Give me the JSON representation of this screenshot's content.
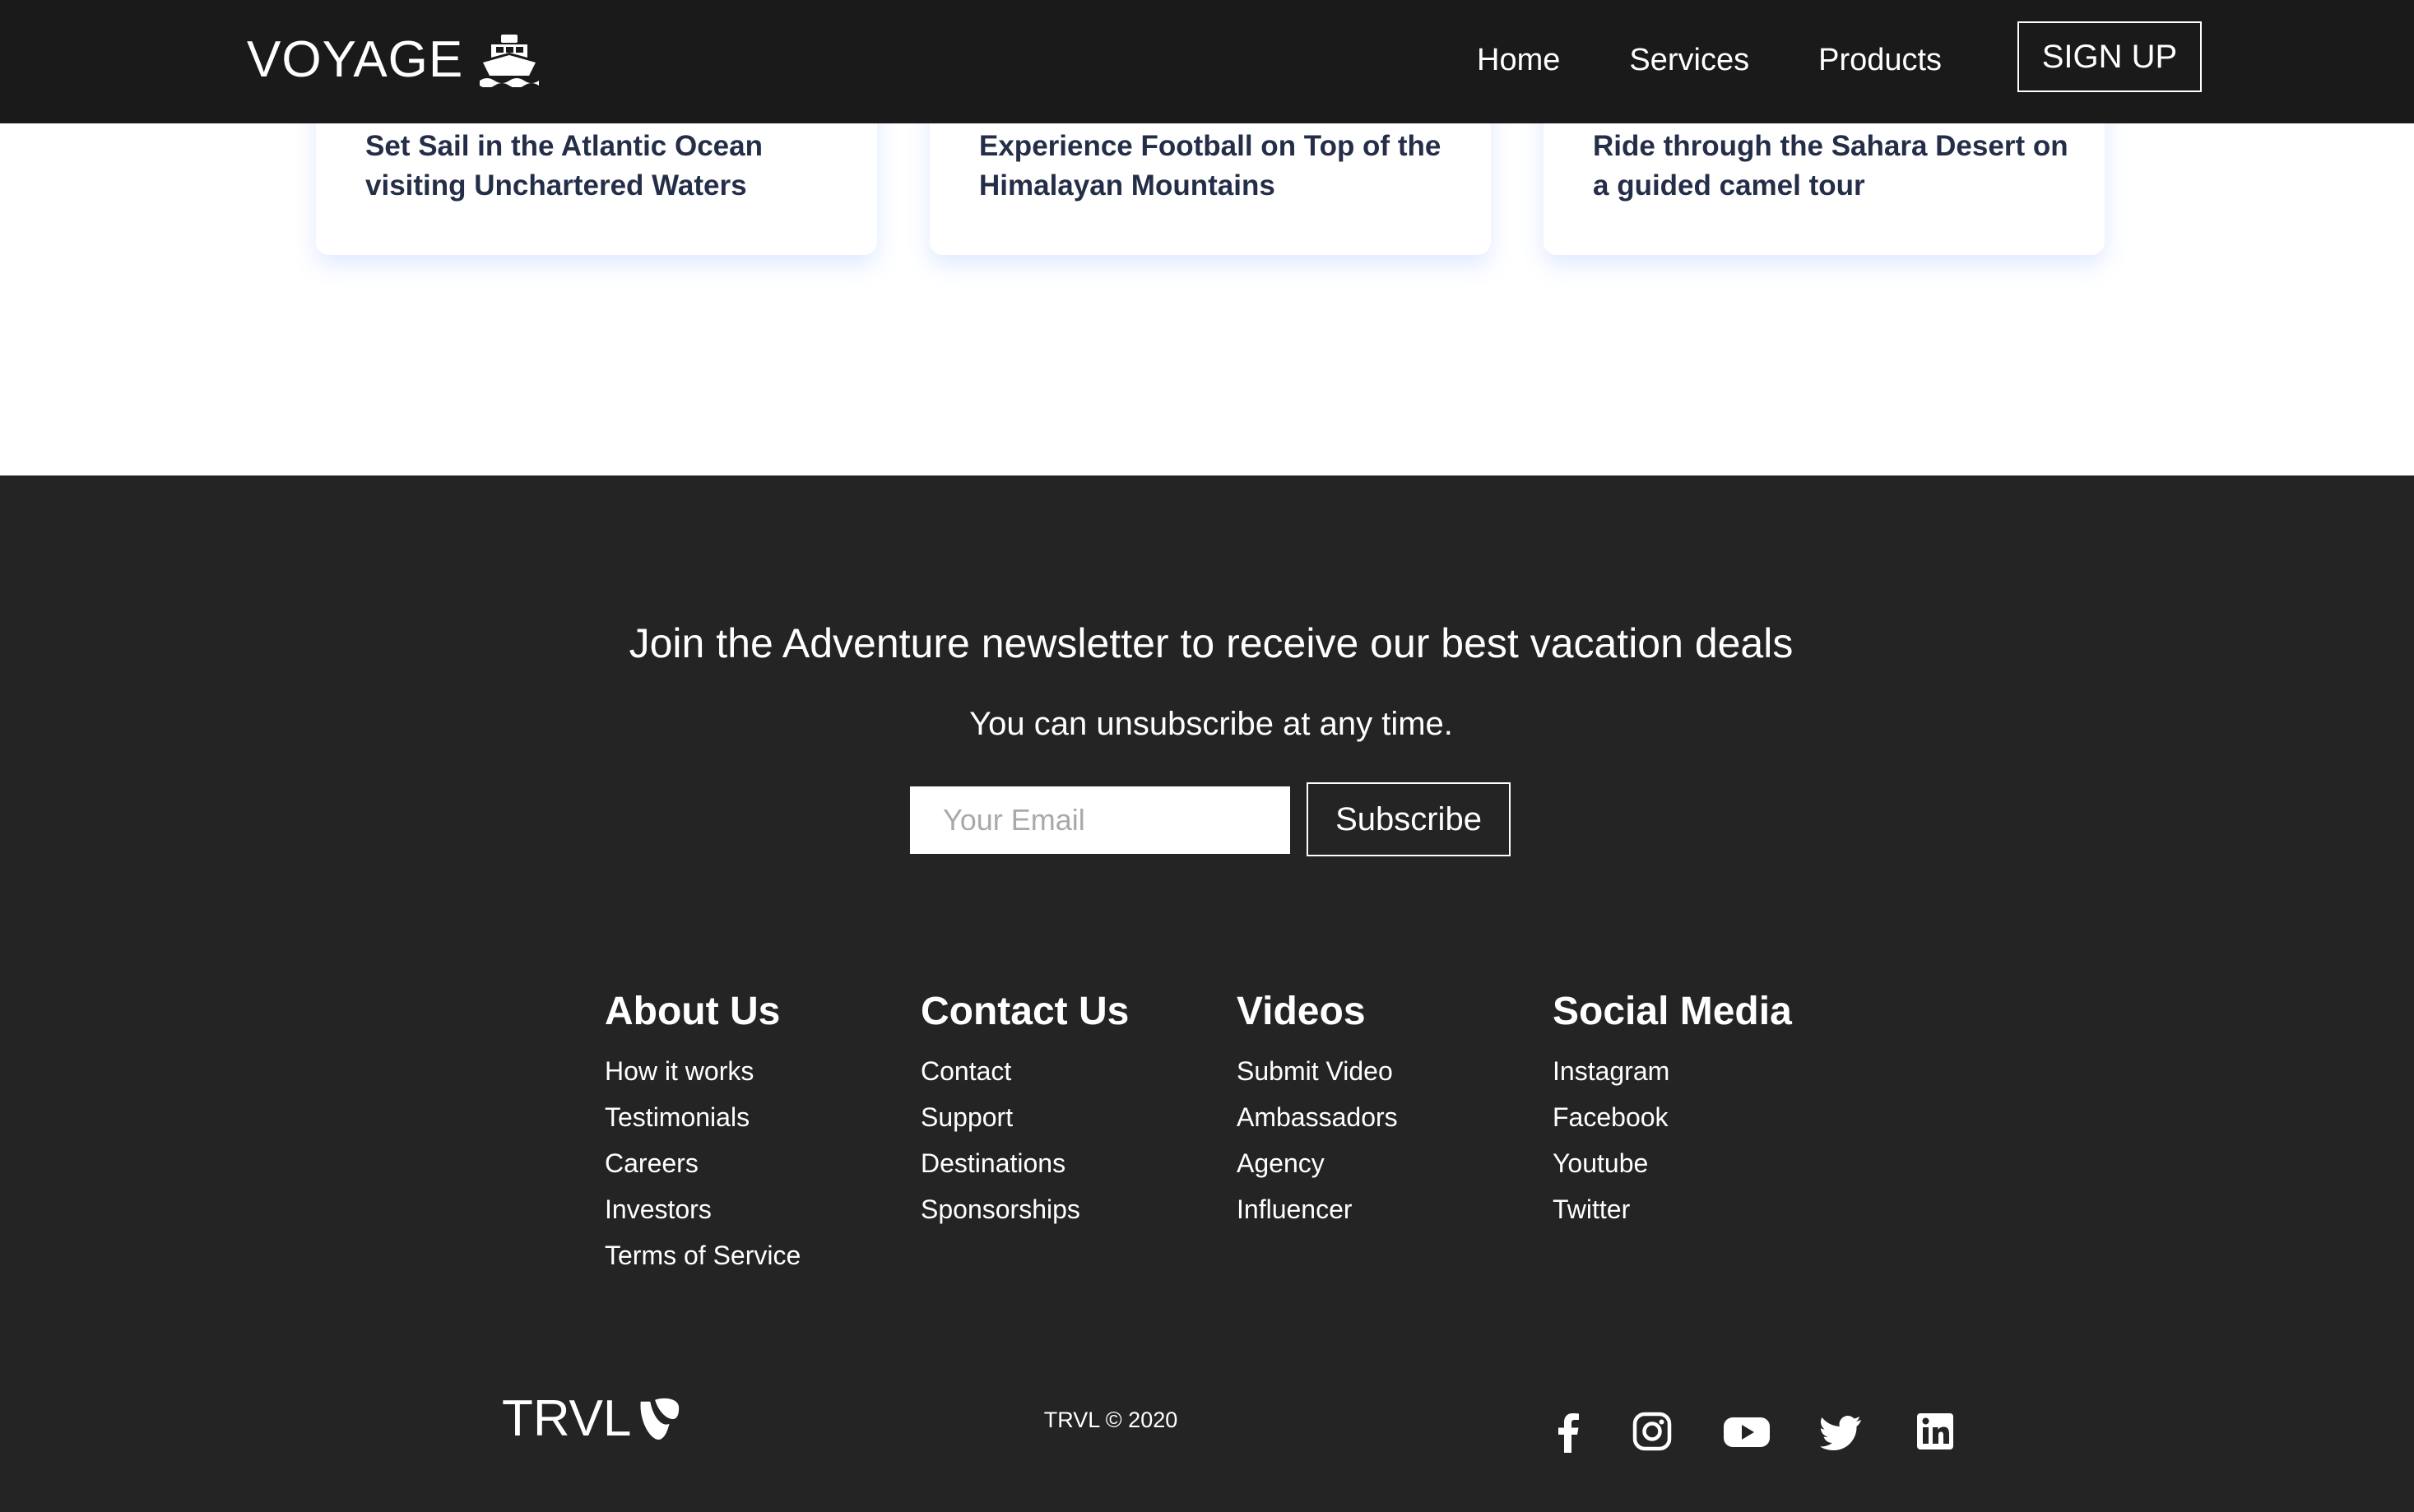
{
  "navbar": {
    "logo_text": "VOYAGE",
    "logo_icon": "ship-icon",
    "links": [
      "Home",
      "Services",
      "Products"
    ],
    "signup_label": "SIGN UP"
  },
  "cards": [
    {
      "title": "Set Sail in the Atlantic Ocean visiting Unchartered Waters"
    },
    {
      "title": "Experience Football on Top of the Himalayan Mountains"
    },
    {
      "title": "Ride through the Sahara Desert on a guided camel tour"
    }
  ],
  "newsletter": {
    "heading": "Join the Adventure newsletter to receive our best vacation deals",
    "subtext": "You can unsubscribe at any time.",
    "email_placeholder": "Your Email",
    "email_value": "",
    "subscribe_label": "Subscribe"
  },
  "footer_columns": [
    {
      "heading": "About Us",
      "links": [
        "How it works",
        "Testimonials",
        "Careers",
        "Investors",
        "Terms of Service"
      ]
    },
    {
      "heading": "Contact Us",
      "links": [
        "Contact",
        "Support",
        "Destinations",
        "Sponsorships"
      ]
    },
    {
      "heading": "Videos",
      "links": [
        "Submit Video",
        "Ambassadors",
        "Agency",
        "Influencer"
      ]
    },
    {
      "heading": "Social Media",
      "links": [
        "Instagram",
        "Facebook",
        "Youtube",
        "Twitter"
      ]
    }
  ],
  "bottom": {
    "logo_text": "TRVL",
    "logo_icon": "typo3-icon",
    "copyright": "TRVL © 2020",
    "social_icons": [
      "facebook-icon",
      "instagram-icon",
      "youtube-icon",
      "twitter-icon",
      "linkedin-icon"
    ]
  },
  "colors": {
    "navbar_bg": "#1b1a1a",
    "footer_bg": "#242424",
    "card_title": "#252e48",
    "text_light": "#ffffff"
  }
}
